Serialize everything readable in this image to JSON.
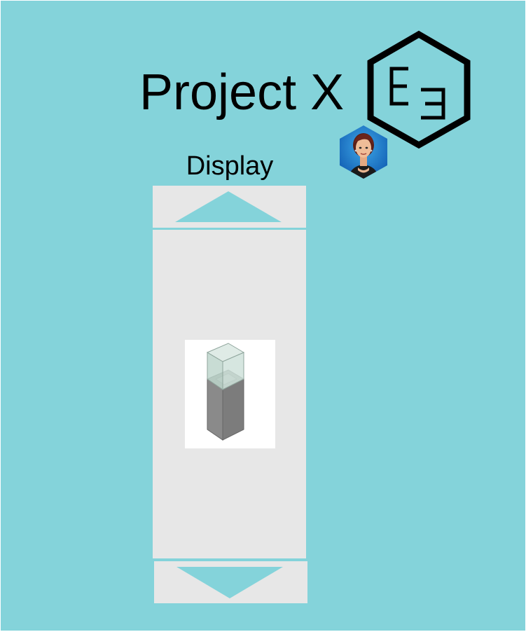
{
  "header": {
    "title": "Project X",
    "logo_text": "EƎ",
    "logo_icon": "hexagon-logo-icon",
    "avatar_icon": "user-avatar-icon"
  },
  "display_panel": {
    "label": "Display",
    "scroll_up_icon": "triangle-up-icon",
    "scroll_down_icon": "triangle-down-icon",
    "item_icon": "display-case-icon"
  },
  "colors": {
    "background": "#84d3da",
    "panel": "#e7e7e7",
    "accent": "#84d3da",
    "logo_stroke": "#000000"
  }
}
